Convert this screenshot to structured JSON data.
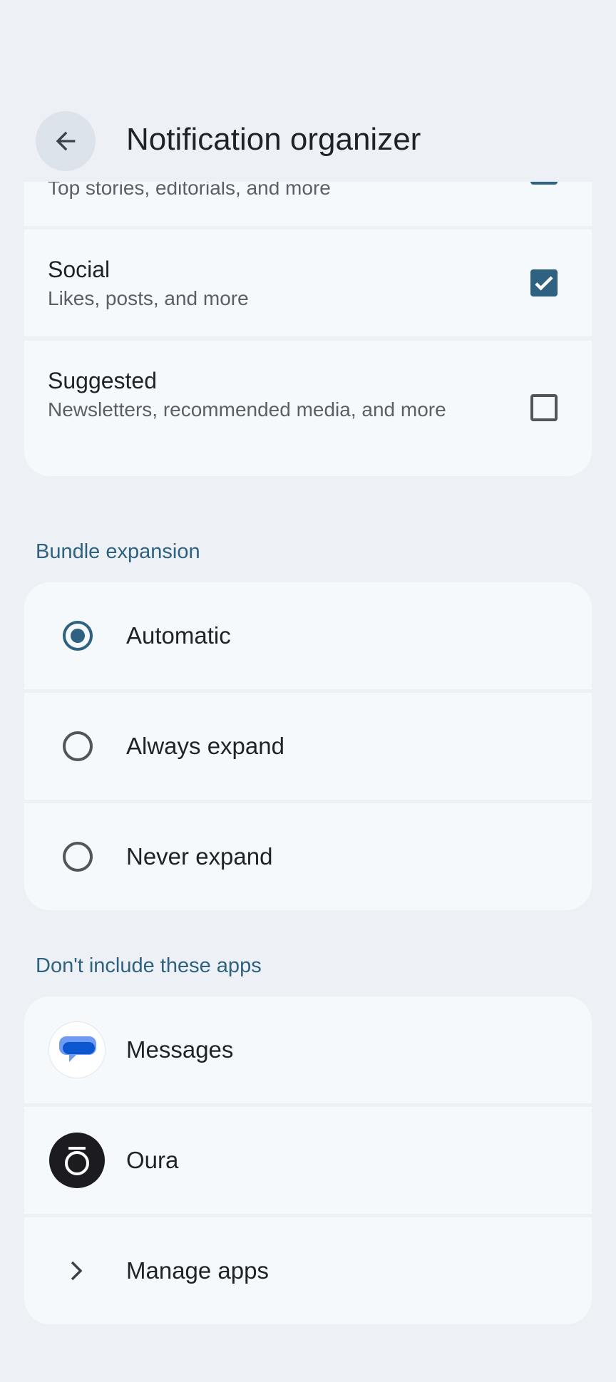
{
  "header": {
    "title": "Notification organizer",
    "back_icon": "arrow-left-icon"
  },
  "categories": [
    {
      "title": "",
      "subtitle": "Top stories, editorials, and more",
      "checked": true
    },
    {
      "title": "Social",
      "subtitle": "Likes, posts, and more",
      "checked": true
    },
    {
      "title": "Suggested",
      "subtitle": "Newsletters, recommended media, and more",
      "checked": false
    }
  ],
  "bundle_expansion": {
    "header": "Bundle expansion",
    "options": [
      {
        "label": "Automatic",
        "selected": true
      },
      {
        "label": "Always expand",
        "selected": false
      },
      {
        "label": "Never expand",
        "selected": false
      }
    ]
  },
  "excluded_apps": {
    "header": "Don't include these apps",
    "apps": [
      {
        "name": "Messages",
        "icon": "messages-app-icon"
      },
      {
        "name": "Oura",
        "icon": "oura-app-icon"
      }
    ],
    "manage_label": "Manage apps",
    "manage_icon": "chevron-right-icon"
  },
  "colors": {
    "background": "#edf1f5",
    "card": "#f6f9fc",
    "accent": "#2e6280"
  }
}
